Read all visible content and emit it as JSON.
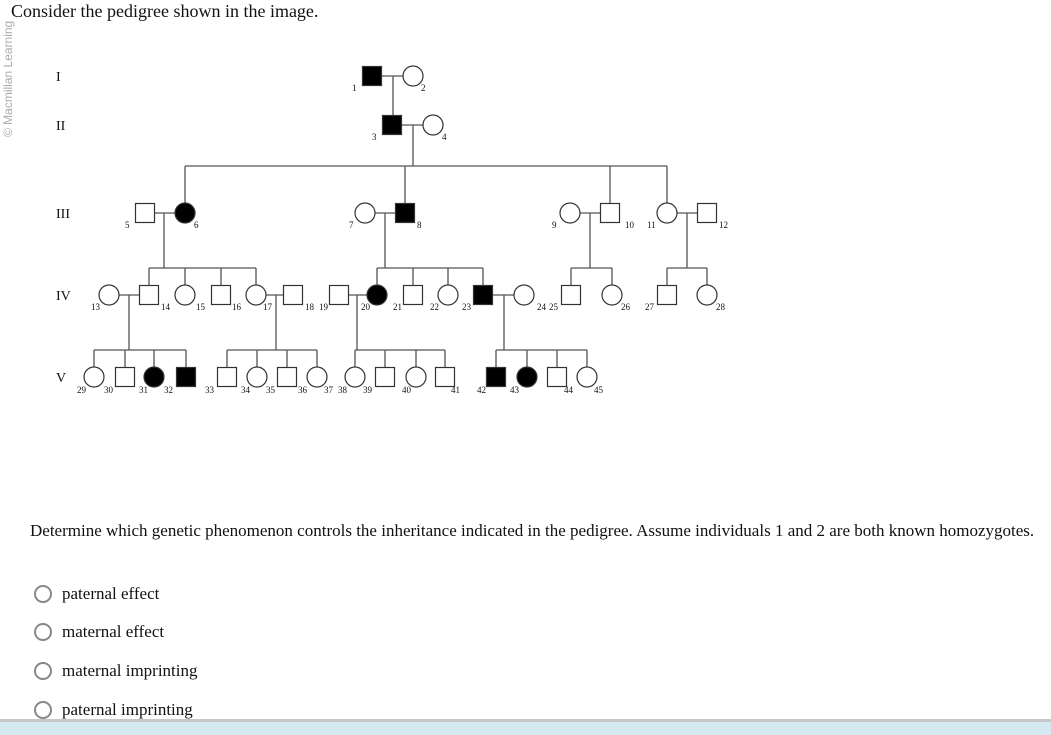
{
  "prompt": "Consider the pedigree shown in the image.",
  "watermark": "© Macmillan Learning",
  "pedigree": {
    "generations": [
      "I",
      "II",
      "III",
      "IV",
      "V"
    ],
    "individuals": [
      {
        "id": "1",
        "sex": "M",
        "affected": true
      },
      {
        "id": "2",
        "sex": "F",
        "affected": false
      },
      {
        "id": "3",
        "sex": "M",
        "affected": true
      },
      {
        "id": "4",
        "sex": "F",
        "affected": false
      },
      {
        "id": "5",
        "sex": "M",
        "affected": false
      },
      {
        "id": "6",
        "sex": "F",
        "affected": true
      },
      {
        "id": "7",
        "sex": "F",
        "affected": false
      },
      {
        "id": "8",
        "sex": "M",
        "affected": true
      },
      {
        "id": "9",
        "sex": "F",
        "affected": false
      },
      {
        "id": "10",
        "sex": "M",
        "affected": false
      },
      {
        "id": "11",
        "sex": "F",
        "affected": false
      },
      {
        "id": "12",
        "sex": "M",
        "affected": false
      },
      {
        "id": "13",
        "sex": "F",
        "affected": false
      },
      {
        "id": "14",
        "sex": "M",
        "affected": false
      },
      {
        "id": "15",
        "sex": "F",
        "affected": false
      },
      {
        "id": "16",
        "sex": "M",
        "affected": false
      },
      {
        "id": "17",
        "sex": "F",
        "affected": false
      },
      {
        "id": "18",
        "sex": "M",
        "affected": false
      },
      {
        "id": "19",
        "sex": "M",
        "affected": false
      },
      {
        "id": "20",
        "sex": "F",
        "affected": true
      },
      {
        "id": "21",
        "sex": "M",
        "affected": false
      },
      {
        "id": "22",
        "sex": "F",
        "affected": false
      },
      {
        "id": "23",
        "sex": "M",
        "affected": true
      },
      {
        "id": "24",
        "sex": "F",
        "affected": false
      },
      {
        "id": "25",
        "sex": "M",
        "affected": false
      },
      {
        "id": "26",
        "sex": "F",
        "affected": false
      },
      {
        "id": "27",
        "sex": "M",
        "affected": false
      },
      {
        "id": "28",
        "sex": "F",
        "affected": false
      },
      {
        "id": "v1",
        "sex": "F",
        "affected": false
      },
      {
        "id": "v2",
        "sex": "M",
        "affected": false
      },
      {
        "id": "v3",
        "sex": "F",
        "affected": true
      },
      {
        "id": "v4",
        "sex": "M",
        "affected": true
      },
      {
        "id": "v5",
        "sex": "M",
        "affected": false
      },
      {
        "id": "v6",
        "sex": "F",
        "affected": false
      },
      {
        "id": "v7",
        "sex": "M",
        "affected": false
      },
      {
        "id": "v8",
        "sex": "F",
        "affected": false
      },
      {
        "id": "v9",
        "sex": "F",
        "affected": false
      },
      {
        "id": "v10",
        "sex": "M",
        "affected": false
      },
      {
        "id": "v11",
        "sex": "F",
        "affected": false
      },
      {
        "id": "v12",
        "sex": "M",
        "affected": false
      },
      {
        "id": "v13",
        "sex": "M",
        "affected": true
      },
      {
        "id": "v14",
        "sex": "F",
        "affected": true
      },
      {
        "id": "v15",
        "sex": "M",
        "affected": false
      },
      {
        "id": "v16",
        "sex": "F",
        "affected": false
      }
    ],
    "labels": [
      "1",
      "2",
      "3",
      "4",
      "5",
      "6",
      "7",
      "8",
      "9",
      "10",
      "11",
      "12",
      "13",
      "14",
      "15",
      "16",
      "17",
      "18",
      "19",
      "20",
      "21",
      "22",
      "23",
      "24",
      "25",
      "26",
      "27",
      "28",
      "29",
      "30",
      "31",
      "32",
      "33",
      "34",
      "35",
      "36",
      "37",
      "38",
      "39",
      "40",
      "41",
      "42",
      "43",
      "44",
      "45"
    ]
  },
  "question": {
    "text": "Determine which genetic phenomenon controls the inheritance indicated in the pedigree. Assume individuals 1 and 2 are both known homozygotes.",
    "options": [
      "paternal effect",
      "maternal effect",
      "maternal imprinting",
      "paternal imprinting"
    ]
  },
  "colors": {
    "affected": "#000000",
    "line": "#555555",
    "radio_border": "#888888",
    "bottom_bar": "#d3e9ef"
  }
}
